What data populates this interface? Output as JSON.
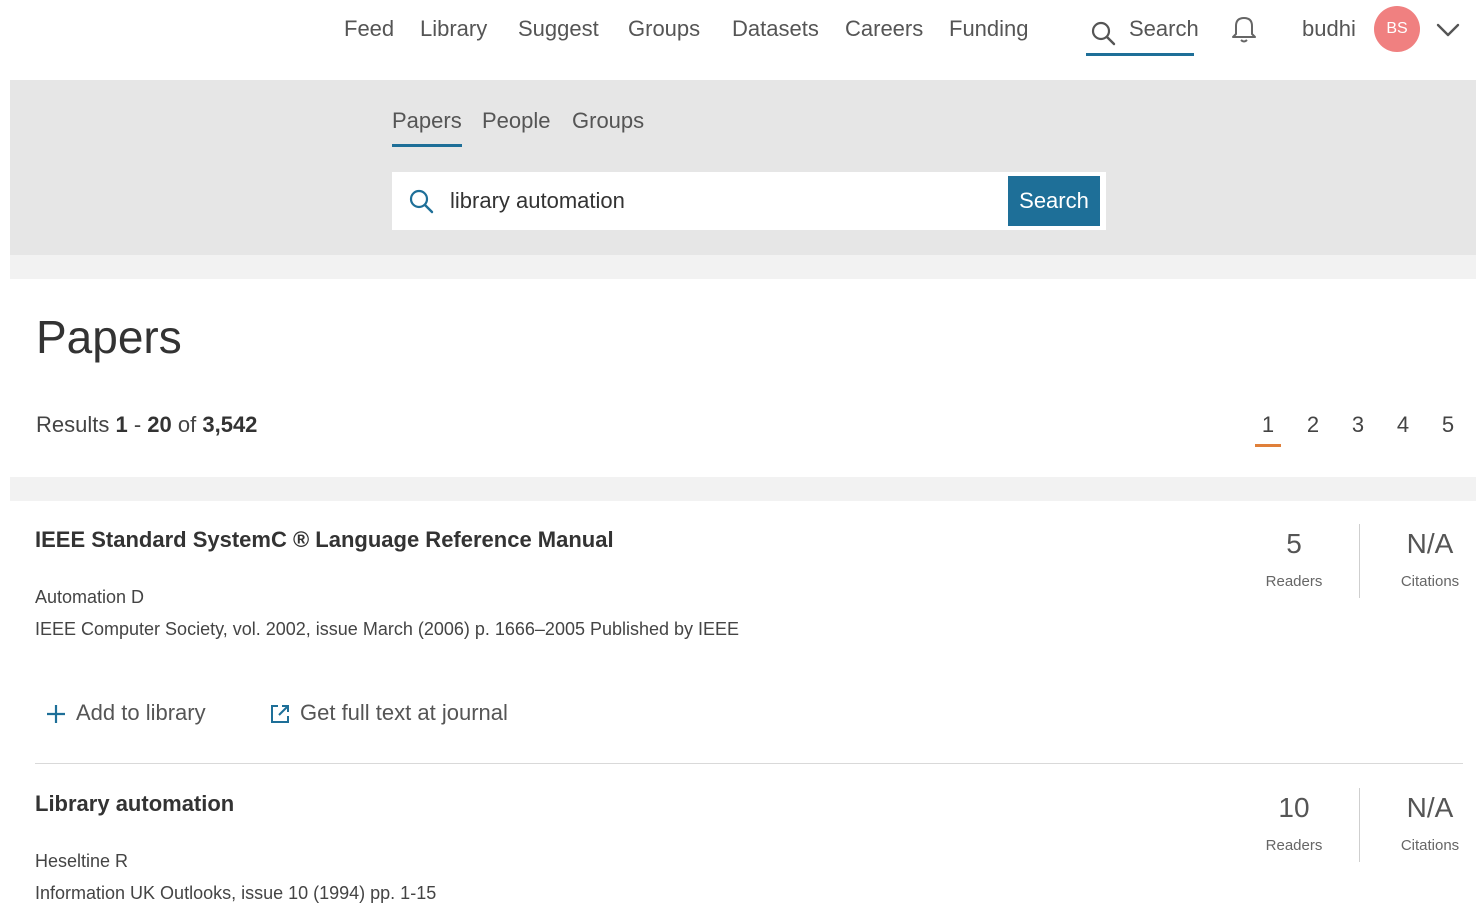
{
  "topnav": {
    "items": [
      "Feed",
      "Library",
      "Suggest",
      "Groups",
      "Datasets",
      "Careers",
      "Funding"
    ],
    "search_label": "Search",
    "username": "budhi",
    "avatar_initials": "BS"
  },
  "search": {
    "tabs": [
      "Papers",
      "People",
      "Groups"
    ],
    "active_tab": "Papers",
    "query": "library automation",
    "button_label": "Search"
  },
  "results": {
    "heading": "Papers",
    "prefix": "Results",
    "range_start": "1",
    "range_sep": " - ",
    "range_end": "20",
    "of": " of ",
    "total": "3,542",
    "pages": [
      "1",
      "2",
      "3",
      "4",
      "5"
    ],
    "current_page": "1"
  },
  "papers": [
    {
      "title": "IEEE Standard SystemC ® Language Reference Manual",
      "authors": "Automation D",
      "source": "IEEE Computer Society, vol. 2002, issue March (2006) p. 1666–2005 Published by IEEE",
      "readers": "5",
      "readers_label": "Readers",
      "citations": "N/A",
      "citations_label": "Citations"
    },
    {
      "title": "Library automation",
      "authors": "Heseltine R",
      "source": "Information UK Outlooks, issue 10 (1994) pp. 1-15",
      "readers": "10",
      "readers_label": "Readers",
      "citations": "N/A",
      "citations_label": "Citations"
    }
  ],
  "actions": {
    "add_to_library": "Add to library",
    "full_text": "Get full text at journal"
  },
  "colors": {
    "accent": "#1e6f98",
    "avatar": "#f08080",
    "pager_active": "#e0803a",
    "band": "#e6e6e6"
  }
}
